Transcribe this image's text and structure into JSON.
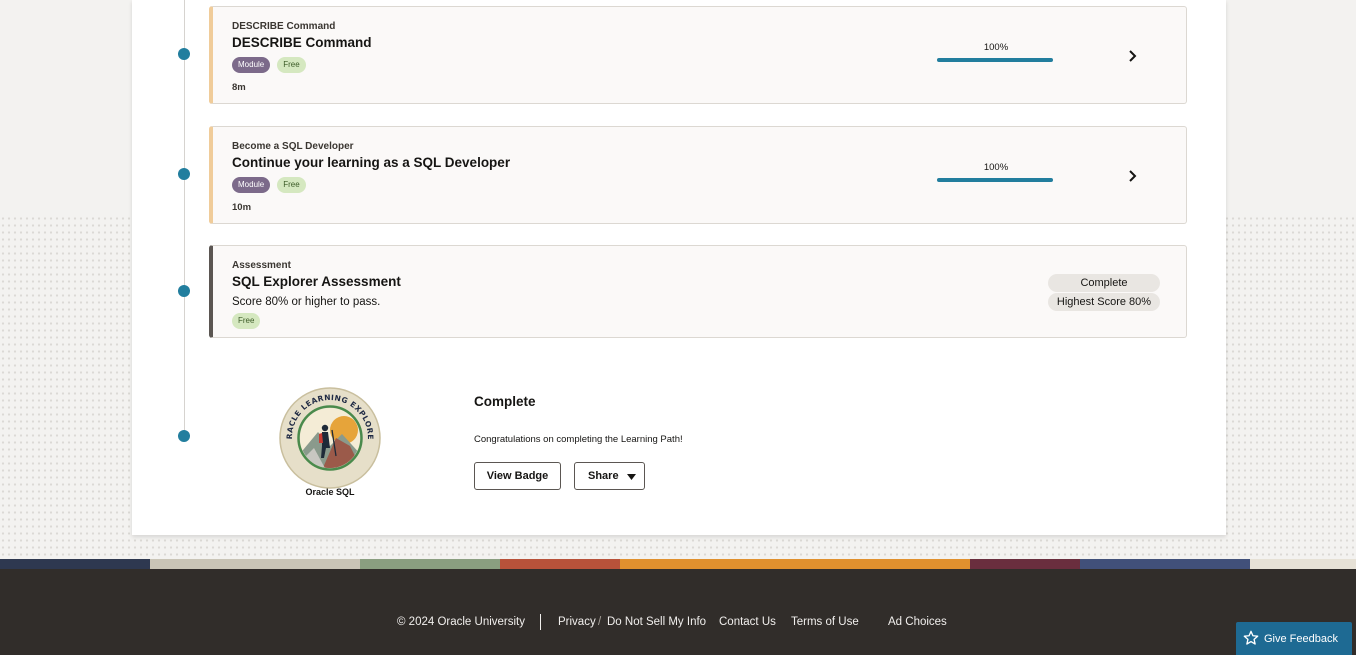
{
  "items": [
    {
      "kicker": "DESCRIBE Command",
      "title": "DESCRIBE Command",
      "badges": [
        "Module",
        "Free"
      ],
      "duration": "8m",
      "progress_text": "100%",
      "progress_value": 1.0
    },
    {
      "kicker": "Become a SQL Developer",
      "title": "Continue your learning as a SQL Developer",
      "badges": [
        "Module",
        "Free"
      ],
      "duration": "10m",
      "progress_text": "100%",
      "progress_value": 1.0
    }
  ],
  "assessment": {
    "kicker": "Assessment",
    "title": "SQL Explorer Assessment",
    "description": "Score 80% or higher to pass.",
    "badge": "Free",
    "status": "Complete",
    "score": "Highest Score 80%"
  },
  "completion": {
    "title": "Complete",
    "message": "Congratulations on completing the Learning Path!",
    "view_badge_label": "View Badge",
    "share_label": "Share",
    "badge_ring_text": "ORACLE LEARNING EXPLORER",
    "badge_caption": "Oracle SQL"
  },
  "footer": {
    "copyright": "© 2024 Oracle University",
    "privacy": "Privacy",
    "separator": "/",
    "do_not_sell": "Do Not Sell My Info",
    "contact": "Contact Us",
    "terms": "Terms of Use",
    "ad_choices": "Ad Choices"
  },
  "feedback": {
    "label": "Give Feedback",
    "icon": "star-icon"
  },
  "colors": {
    "timeline_dot": "#227e9e",
    "progress_bar": "#227e9e",
    "module_badge": "#7c6a8a",
    "free_badge": "#d5e8c0",
    "footer_bg": "#312d2a",
    "feedback_bg": "#1e6a93"
  }
}
